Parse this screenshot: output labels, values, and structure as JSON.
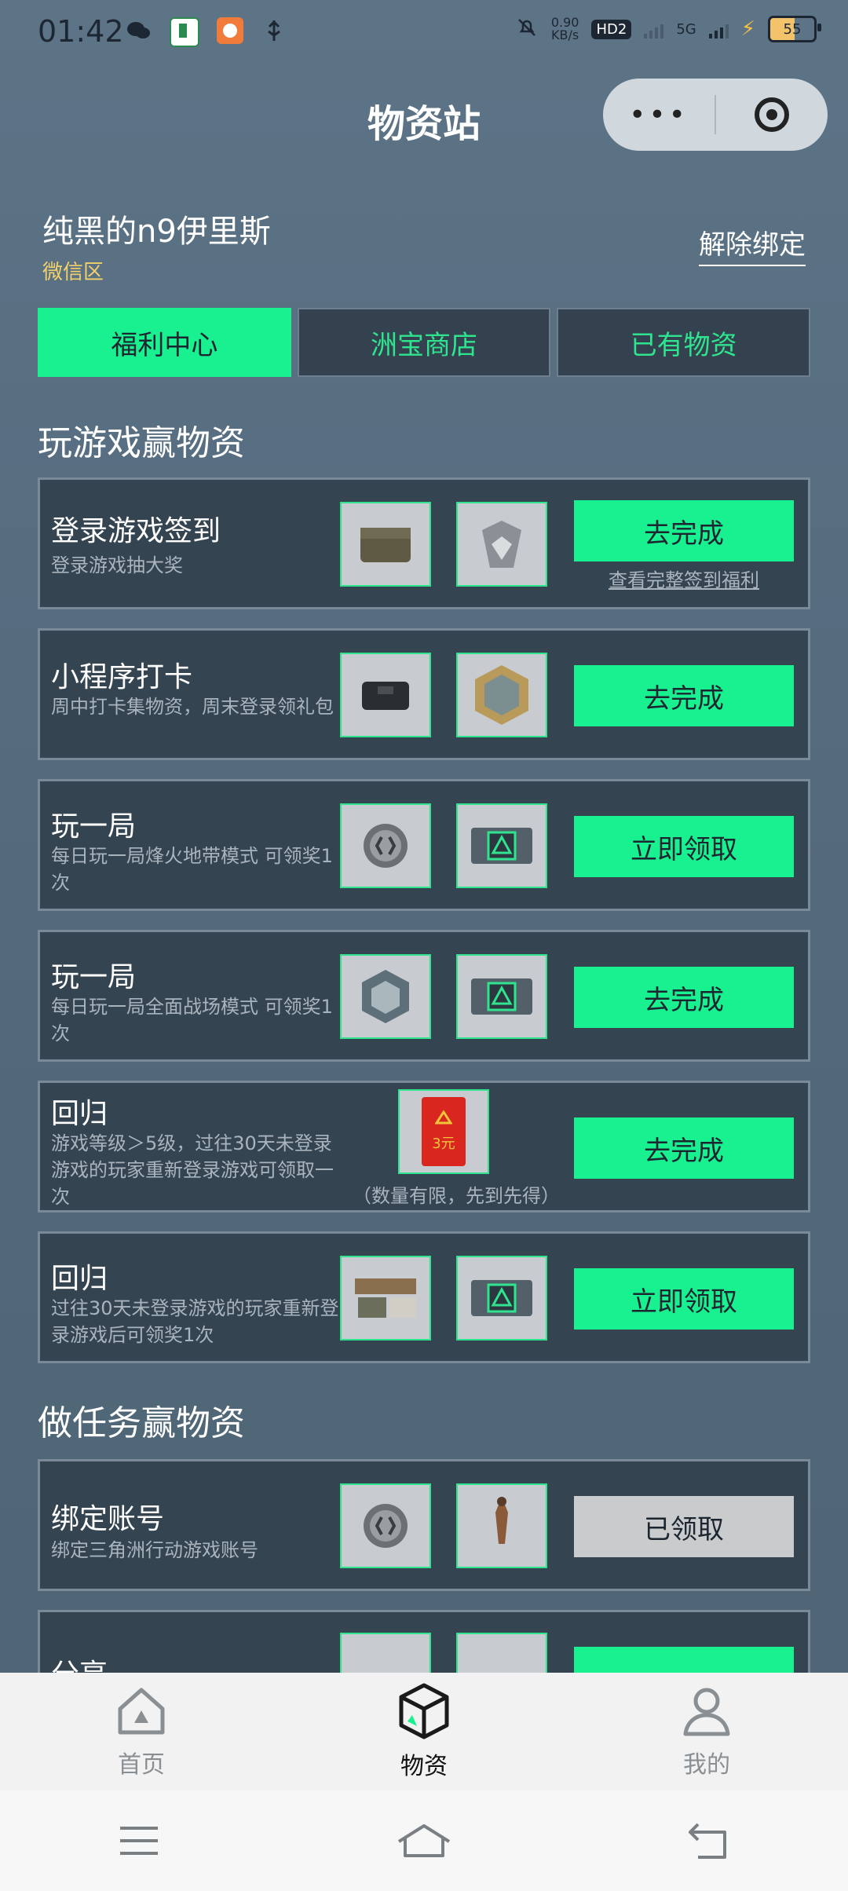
{
  "status": {
    "time": "01:42",
    "net_speed": "0.90",
    "net_unit": "KB/s",
    "hd": "HD2",
    "network": "5G",
    "battery": "55"
  },
  "nav": {
    "title": "物资站",
    "menu_dots": "•••"
  },
  "user": {
    "name": "纯黑的n9伊里斯",
    "region": "微信区",
    "unbind": "解除绑定"
  },
  "tabs": [
    "福利中心",
    "洲宝商店",
    "已有物资"
  ],
  "sections": {
    "play": "玩游戏赢物资",
    "tasks": "做任务赢物资"
  },
  "play_cards": [
    {
      "title": "登录游戏签到",
      "desc": "登录游戏抽大奖",
      "action": "去完成",
      "sublink": "查看完整签到福利"
    },
    {
      "title": "小程序打卡",
      "desc": "周中打卡集物资，周末登录领礼包",
      "action": "去完成"
    },
    {
      "title": "玩一局",
      "desc": "每日玩一局烽火地带模式 可领奖1次",
      "action": "立即领取"
    },
    {
      "title": "玩一局",
      "desc": "每日玩一局全面战场模式 可领奖1次",
      "action": "去完成"
    },
    {
      "title": "回归",
      "desc": "游戏等级＞5级，过往30天未登录游戏的玩家重新登录游戏可领取一次",
      "action": "去完成",
      "note": "（数量有限，先到先得）",
      "coupon": "3元"
    },
    {
      "title": "回归",
      "desc": "过往30天未登录游戏的玩家重新登录游戏后可领奖1次",
      "action": "立即领取"
    }
  ],
  "task_cards": [
    {
      "title": "绑定账号",
      "desc": "绑定三角洲行动游戏账号",
      "action": "已领取"
    },
    {
      "title": "分享"
    }
  ],
  "tabbar": [
    "首页",
    "物资",
    "我的"
  ]
}
